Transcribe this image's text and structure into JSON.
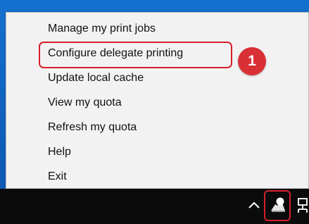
{
  "context_menu": {
    "items": [
      {
        "label": "Manage my print jobs"
      },
      {
        "label": "Configure delegate printing"
      },
      {
        "label": "Update local cache"
      },
      {
        "label": "View my quota"
      },
      {
        "label": "Refresh my quota"
      },
      {
        "label": "Help"
      },
      {
        "label": "Exit"
      }
    ]
  },
  "annotation": {
    "step_number": "1",
    "color": "#d61f2c"
  },
  "taskbar": {
    "background": "#0b0b0b",
    "icons": [
      "chevron-up-icon",
      "print-client-icon",
      "network-icon"
    ]
  }
}
